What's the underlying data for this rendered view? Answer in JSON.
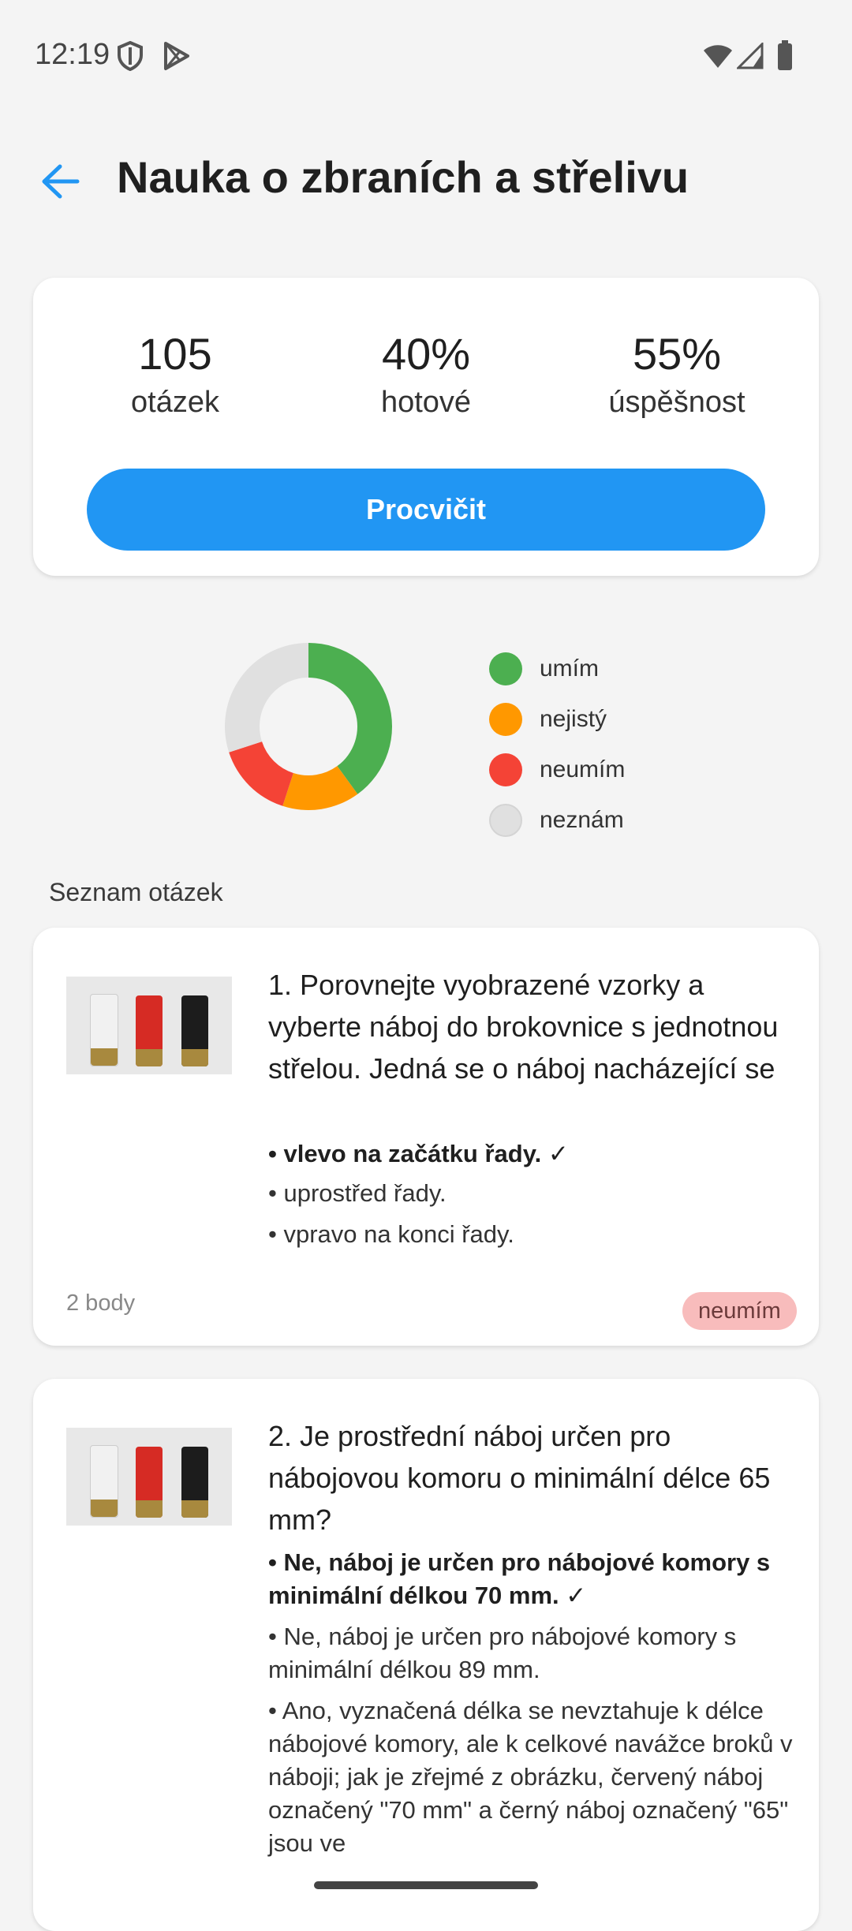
{
  "status_bar": {
    "time": "12:19"
  },
  "app_bar": {
    "title": "Nauka o zbraních a střelivu",
    "back_icon": "arrow-back-icon"
  },
  "stats": [
    {
      "value": "105",
      "label": "otázek"
    },
    {
      "value": "40%",
      "label": "hotové"
    },
    {
      "value": "55%",
      "label": "úspěšnost"
    }
  ],
  "practice_button": "Procvičit",
  "chart_data": {
    "type": "pie",
    "categories": [
      "umím",
      "nejistý",
      "neumím",
      "neznám"
    ],
    "values": [
      40,
      15,
      15,
      30
    ],
    "colors": [
      "#4caf50",
      "#ff9800",
      "#f44336",
      "#e0e0e0"
    ],
    "donut": true
  },
  "legend": [
    {
      "label": "umím",
      "color": "#4caf50"
    },
    {
      "label": "nejistý",
      "color": "#ff9800"
    },
    {
      "label": "neumím",
      "color": "#f44336"
    },
    {
      "label": "neznám",
      "color": "#e0e0e0"
    }
  ],
  "section_title": "Seznam otázek",
  "questions": [
    {
      "text": "1. Porovnejte vyobrazené vzorky a vyberte náboj do brokovnice s jednotnou střelou. Jedná se o náboj nacházející se",
      "answers": [
        "• vlevo na začátku řady. ✓",
        "• uprostřed řady.",
        "• vpravo na konci řady."
      ],
      "points": "2 body",
      "badge": "neumím"
    },
    {
      "text": "2. Je prostřední náboj určen pro nábojovou komoru o minimální délce 65 mm?",
      "answers": [
        "• Ne, náboj je určen pro nábojové komory s minimální délkou 70 mm. ✓",
        "• Ne, náboj je určen pro nábojové komory s minimální délkou 89 mm.",
        "• Ano, vyznačená délka se nevztahuje k délce nábojové komory, ale k celkové navážce broků v náboji; jak je zřejmé z obrázku, červený náboj označený \"70 mm\" a černý náboj označený \"65\" jsou ve"
      ]
    }
  ]
}
